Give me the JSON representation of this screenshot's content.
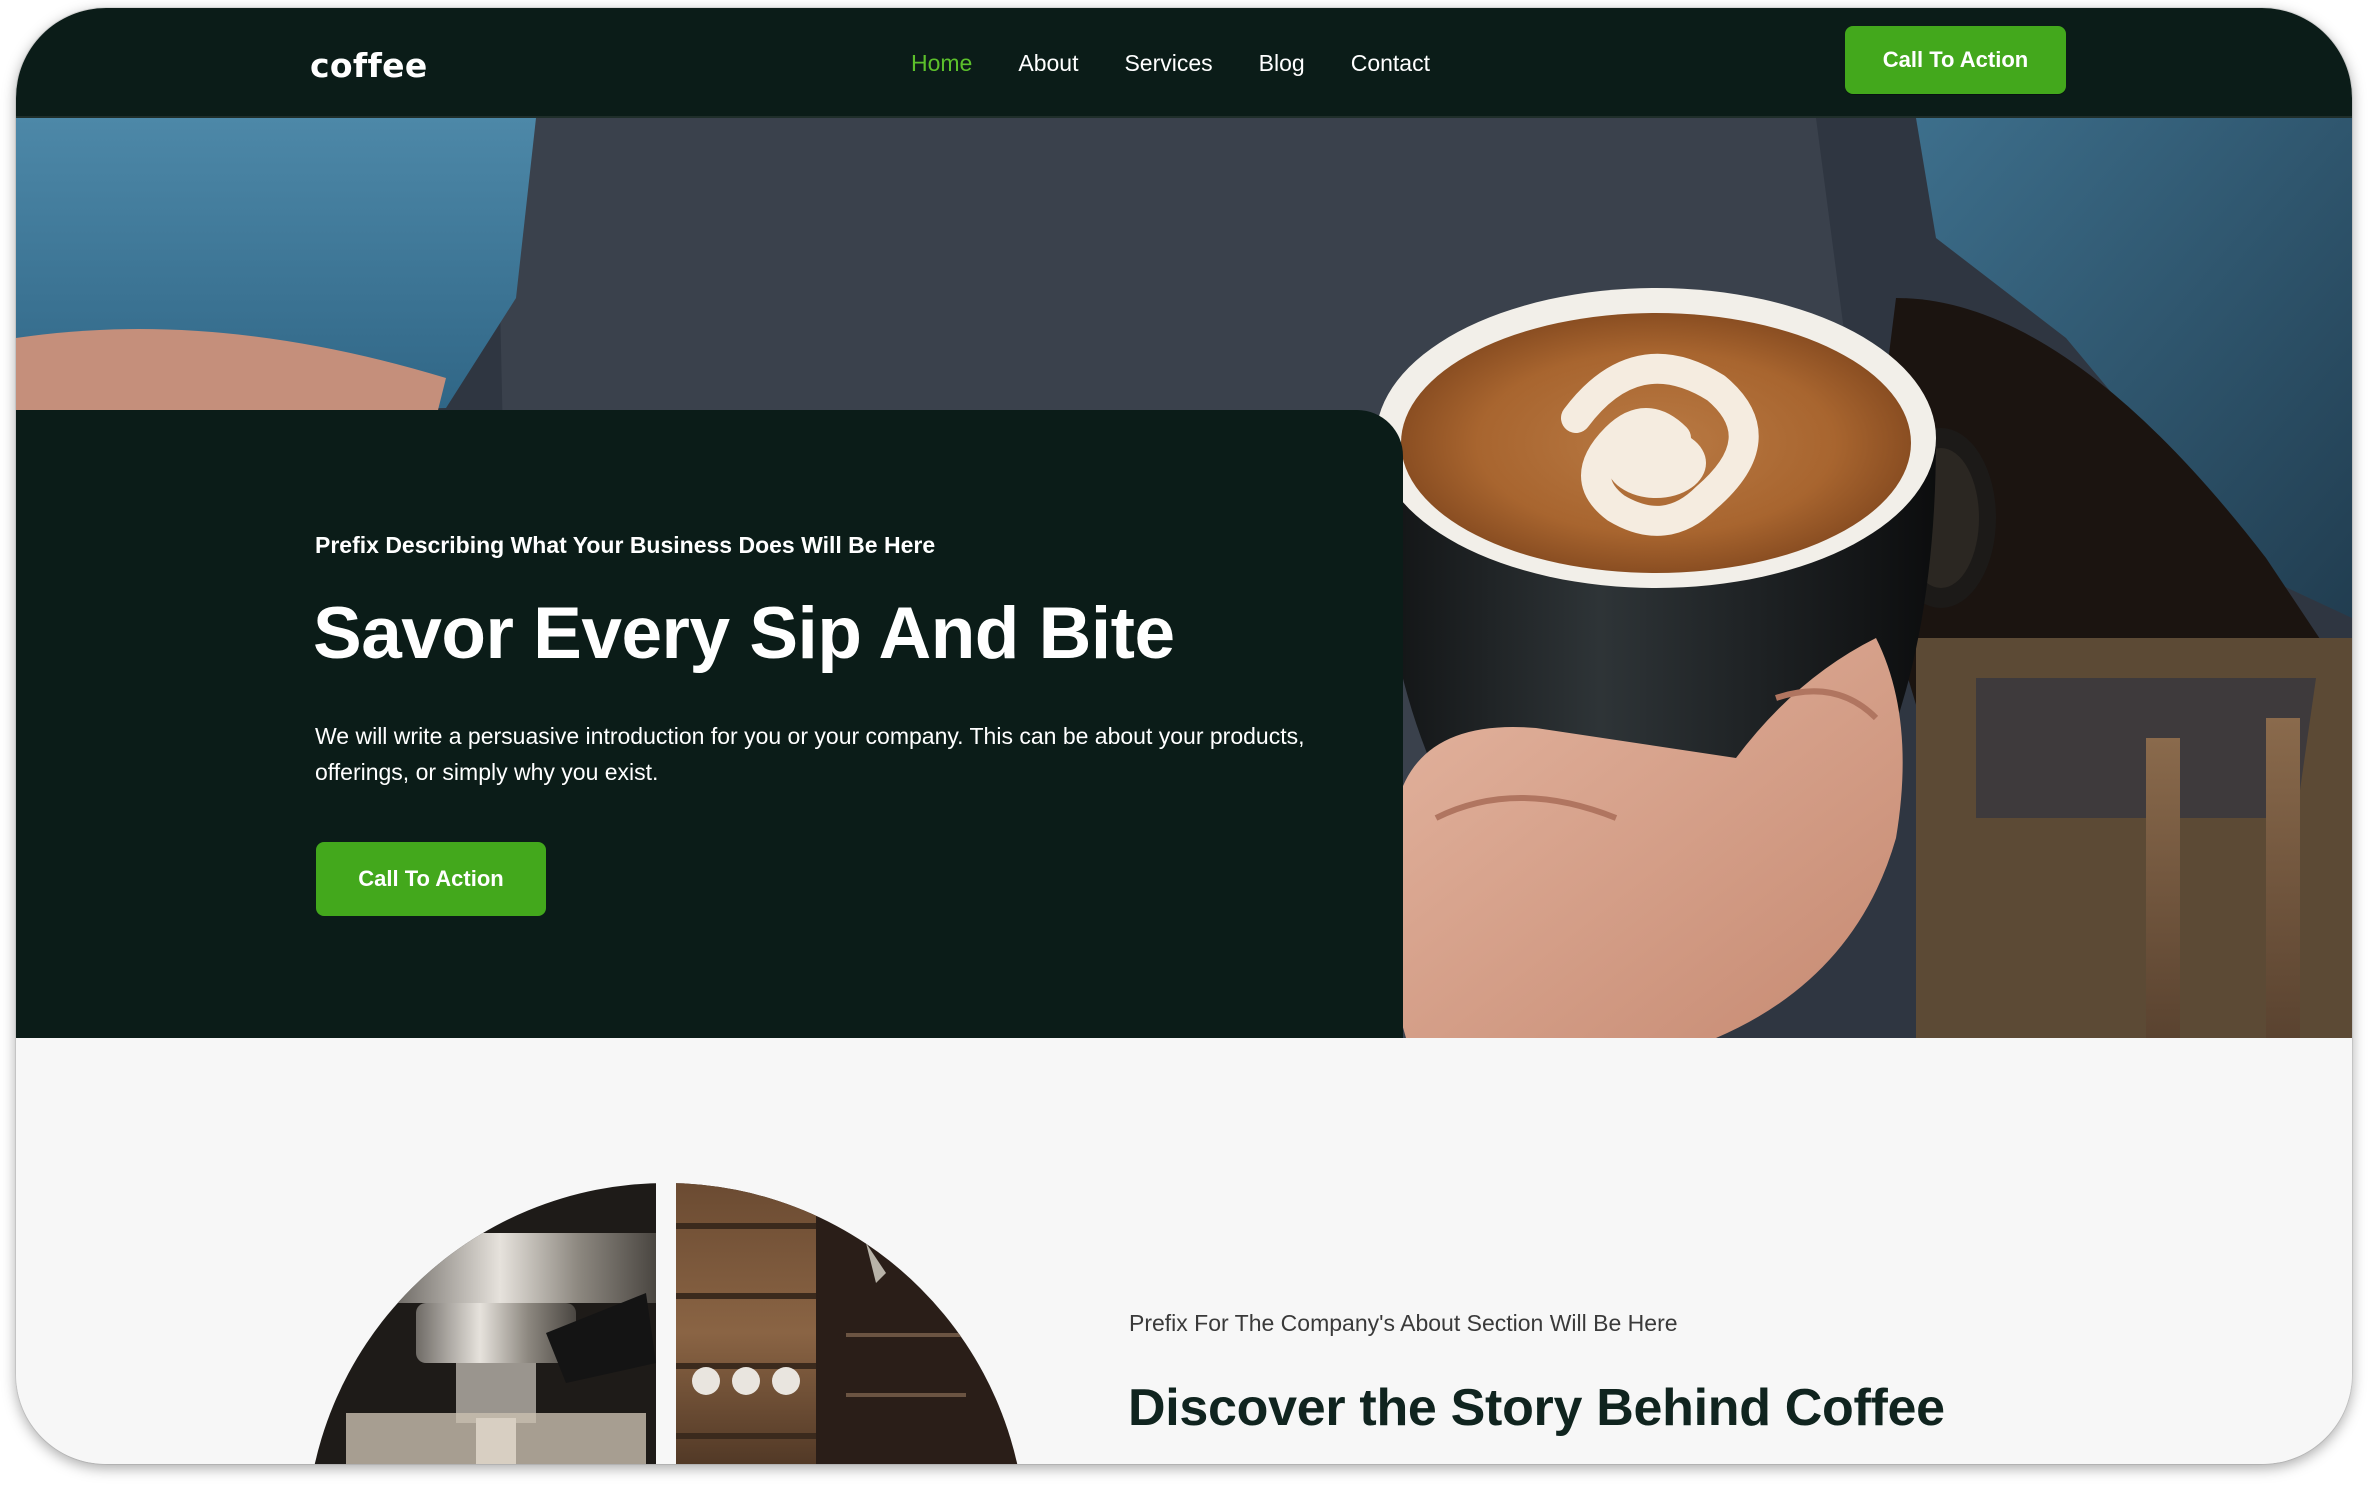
{
  "navbar": {
    "logo": "coffee",
    "links": [
      {
        "label": "Home",
        "active": true
      },
      {
        "label": "About",
        "active": false
      },
      {
        "label": "Services",
        "active": false
      },
      {
        "label": "Blog",
        "active": false
      },
      {
        "label": "Contact",
        "active": false
      }
    ],
    "cta_label": "Call To Action"
  },
  "hero": {
    "prefix": "Prefix Describing What Your Business Does Will Be Here",
    "title": "Savor Every Sip And Bite",
    "intro": "We will write a persuasive introduction for you or your company. This can be about your products, offerings, or simply why you exist.",
    "cta_label": "Call To Action",
    "image": "latte-cup-in-hands-photo"
  },
  "about": {
    "prefix": "Prefix For The Company's About Section Will Be Here",
    "title": "Discover the Story Behind Coffee",
    "images": [
      "espresso-machine-photo",
      "cafe-shelves-photo"
    ]
  },
  "colors": {
    "dark_green": "#0b1c18",
    "accent_green": "#43a81c",
    "active_link": "#5cc02b",
    "section_bg": "#f7f7f7"
  }
}
